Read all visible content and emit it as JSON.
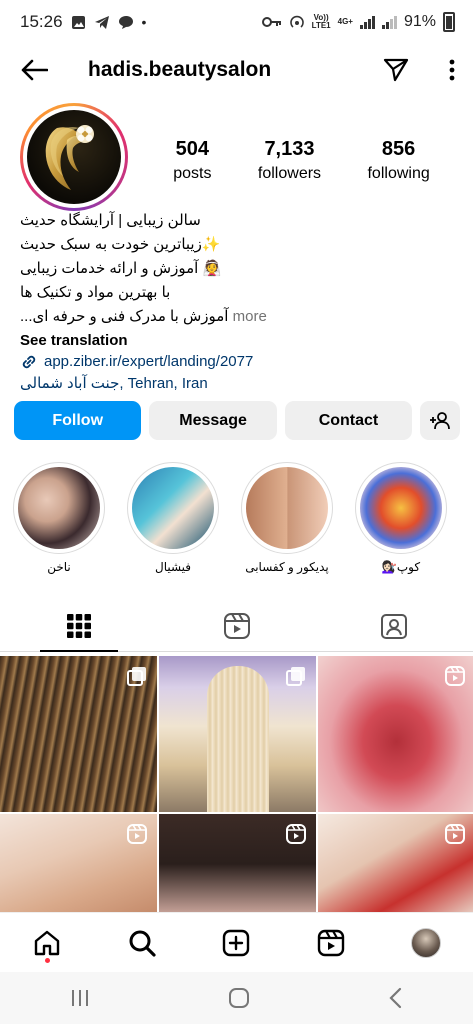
{
  "status_bar": {
    "time": "15:26",
    "network_top": "Vo))",
    "network_bottom": "LTE1",
    "network2_top": "4G+",
    "network2_bottom": "",
    "battery": "91%"
  },
  "header": {
    "username": "hadis.beautysalon"
  },
  "profile": {
    "stats": [
      {
        "num": "504",
        "label": "posts"
      },
      {
        "num": "7,133",
        "label": "followers"
      },
      {
        "num": "856",
        "label": "following"
      }
    ]
  },
  "bio": {
    "line1": "سالن زیبایی | آرایشگاه حدیث",
    "line2": "✨زیباترین خودت به سبک حدیث",
    "line3": "👰 آموزش و ارائه خدمات زیبایی",
    "line4": "با بهترین مواد و تکنیک ها",
    "line5": "آموزش با مدرک فنی و حرفه ای...",
    "more": "more",
    "see_translation": "See translation",
    "link": "app.ziber.ir/expert/landing/2077",
    "location": "جنت آباد شمالی, Tehran, Iran"
  },
  "buttons": {
    "follow": "Follow",
    "message": "Message",
    "contact": "Contact"
  },
  "highlights": [
    {
      "label": "ناخن"
    },
    {
      "label": "فیشیال"
    },
    {
      "label": "پدیکور و کفسابی"
    },
    {
      "label": "کوپ💇🏻‍♀️"
    }
  ],
  "colors": {
    "accent": "#0095f6",
    "link": "#00376b",
    "muted": "#737373",
    "notification_dot": "#ff3040"
  }
}
